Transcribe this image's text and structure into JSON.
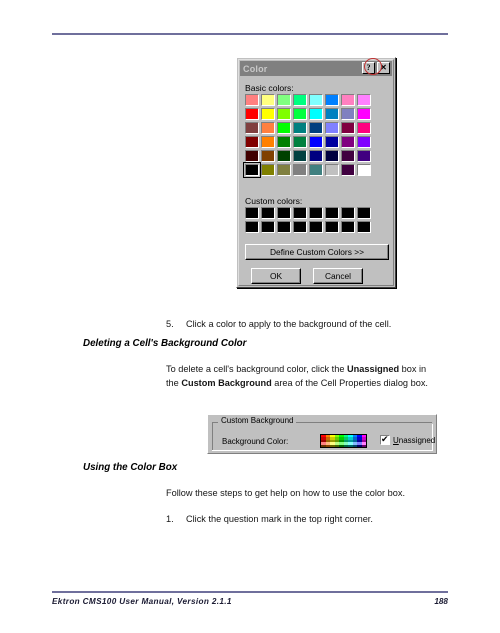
{
  "document": {
    "footer_left": "Ektron CMS100 User Manual, Version 2.1.1",
    "footer_page": "188",
    "rule_color": "#6f6f9c"
  },
  "body_content": {
    "step5": {
      "number": "5.",
      "text": "Click a color to apply to the background of the cell."
    },
    "heading_deleting": "Deleting a Cell's Background Color",
    "para_delete_line1_a": "To delete a cell's background color, click the ",
    "para_delete_line1_b": "Unassigned",
    "para_delete_line1_c": " box in",
    "para_delete_line2_a": "the ",
    "para_delete_line2_b": "Custom Background",
    "para_delete_line2_c": " area of the Cell Properties dialog box.",
    "heading_using": "Using the Color Box",
    "para_follow": "Follow these steps to get help on how to use the color box.",
    "step1": {
      "number": "1.",
      "text": "Click the question mark in the top right corner."
    }
  },
  "color_dialog": {
    "title": "Color",
    "help_button": "?",
    "close_button": "✕",
    "basic_colors_label": "Basic colors:",
    "custom_colors_label": "Custom colors:",
    "define_button": "Define Custom Colors >>",
    "ok_button": "OK",
    "cancel_button": "Cancel",
    "selected_index": 40,
    "basic_colors": [
      "#ff8080",
      "#ffff80",
      "#80ff80",
      "#00ff80",
      "#80ffff",
      "#0080ff",
      "#ff80c0",
      "#ff80ff",
      "#ff0000",
      "#ffff00",
      "#80ff00",
      "#00ff40",
      "#00ffff",
      "#0080c0",
      "#8080c0",
      "#ff00ff",
      "#804040",
      "#ff8040",
      "#00ff00",
      "#008080",
      "#004080",
      "#8080ff",
      "#800040",
      "#ff0080",
      "#800000",
      "#ff8000",
      "#008000",
      "#008040",
      "#0000ff",
      "#0000a0",
      "#800080",
      "#8000ff",
      "#400000",
      "#804000",
      "#004000",
      "#004040",
      "#000080",
      "#000040",
      "#400040",
      "#400080",
      "#000000",
      "#808000",
      "#808040",
      "#808080",
      "#408080",
      "#c0c0c0",
      "#400040",
      "#ffffff"
    ],
    "custom_colors": [
      "#000000",
      "#000000",
      "#000000",
      "#000000",
      "#000000",
      "#000000",
      "#000000",
      "#000000",
      "#000000",
      "#000000",
      "#000000",
      "#000000",
      "#000000",
      "#000000",
      "#000000",
      "#000000"
    ]
  },
  "custom_background_dialog": {
    "group_title": "Custom Background",
    "color_label": "Background Color:",
    "checkbox_label_prefix": "",
    "checkbox_label_underline": "U",
    "checkbox_label_rest": "nassigned",
    "checkbox_checked": true,
    "mini_palette": [
      "#ff0000",
      "#ff8000",
      "#ffff00",
      "#80ff00",
      "#00ff00",
      "#00ff80",
      "#00ffff",
      "#0080ff",
      "#0000ff",
      "#ff00ff",
      "#cc0000",
      "#cc6600",
      "#cccc00",
      "#66cc00",
      "#00cc00",
      "#00cc66",
      "#00cccc",
      "#0066cc",
      "#0000cc",
      "#cc00cc",
      "#990000",
      "#996600",
      "#999900",
      "#669900",
      "#009900",
      "#009966",
      "#009999",
      "#006699",
      "#000099",
      "#990099",
      "#ff8080",
      "#ffbb80",
      "#ffff80",
      "#bbff80",
      "#80ff80",
      "#80ffbb",
      "#80ffff",
      "#80bbff",
      "#8080ff",
      "#ff80ff",
      "#663300",
      "#884400",
      "#666600",
      "#446600",
      "#006600",
      "#006644",
      "#006666",
      "#004466",
      "#000066",
      "#660066"
    ]
  }
}
